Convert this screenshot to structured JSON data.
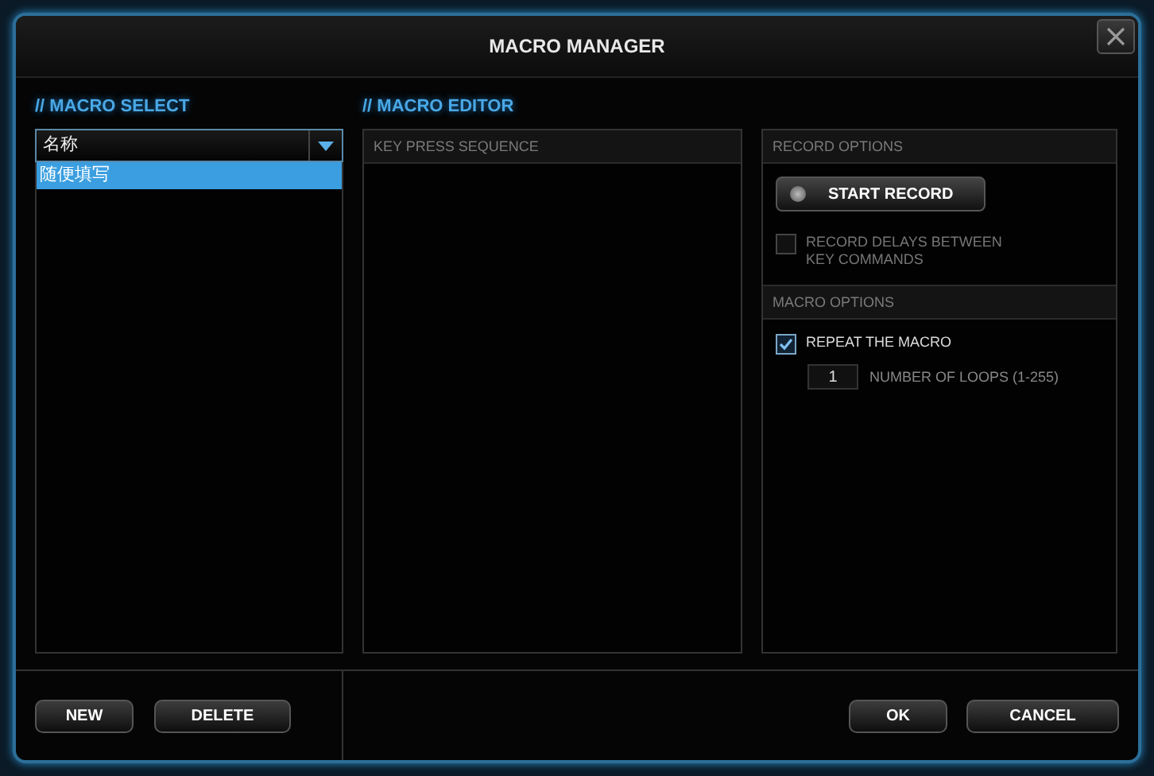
{
  "window": {
    "title": "MACRO MANAGER"
  },
  "macro_select": {
    "heading": "// MACRO SELECT",
    "dropdown": {
      "value": "名称"
    },
    "items": [
      {
        "label": "随便填写",
        "selected": true
      }
    ]
  },
  "macro_editor": {
    "heading": "// MACRO EDITOR",
    "sequence": {
      "title": "KEY PRESS SEQUENCE"
    }
  },
  "record_options": {
    "title": "RECORD OPTIONS",
    "record_button": "START RECORD",
    "record_delays": {
      "label": "RECORD DELAYS BETWEEN KEY COMMANDS",
      "checked": false
    }
  },
  "macro_options": {
    "title": "MACRO OPTIONS",
    "repeat": {
      "label": "REPEAT THE MACRO",
      "checked": true
    },
    "loops": {
      "value": "1",
      "label": "NUMBER OF LOOPS (1-255)"
    }
  },
  "footer": {
    "left_buttons": [
      "NEW",
      "DELETE"
    ],
    "right_buttons": [
      "OK",
      "CANCEL"
    ]
  }
}
